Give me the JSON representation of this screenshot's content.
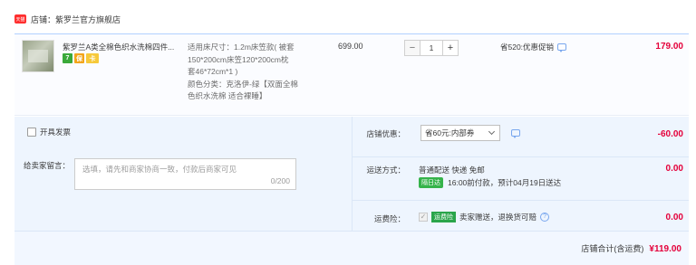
{
  "shop": {
    "icon_label": "天猫",
    "label": "店铺：紫罗兰官方旗舰店"
  },
  "item": {
    "title": "紫罗兰A类全棉色织水洗棉四件...",
    "badges": [
      "7",
      "保",
      "卡"
    ],
    "sku_lines": [
      "适用床尺寸：1.2m床笠款( 被套",
      "150*200cm床笠120*200cm枕",
      "套46*72cm*1 )",
      "颜色分类：克洛伊-绿【双面全棉",
      "色织水洗棉 适合裸睡】"
    ],
    "unit_price": "699.00",
    "quantity": "1",
    "qty_minus": "−",
    "qty_plus": "+",
    "promo": "省520:优惠促销",
    "total": "179.00"
  },
  "order": {
    "invoice_label": "开具发票",
    "message_label": "给卖家留言：",
    "message_placeholder": "选填，请先和商家协商一致，付款后商家可见",
    "message_count": "0/200",
    "coupon_label": "店铺优惠：",
    "coupon_value": "省60元:内部券",
    "coupon_amount": "-60.00",
    "shipping_label": "运送方式：",
    "shipping_text": "普通配送 快递 免邮",
    "shipping_tag": "隔日达",
    "shipping_eta": "16:00前付款，预计04月19日送达",
    "shipping_amount": "0.00",
    "insurance_label": "运费险：",
    "insurance_check": "✓",
    "insurance_tag": "运费险",
    "insurance_text": "卖家赠送，退换货可赔",
    "insurance_amount": "0.00"
  },
  "footer": {
    "total_label": "店铺合计(含运费)",
    "total_amount": "¥119.00"
  }
}
